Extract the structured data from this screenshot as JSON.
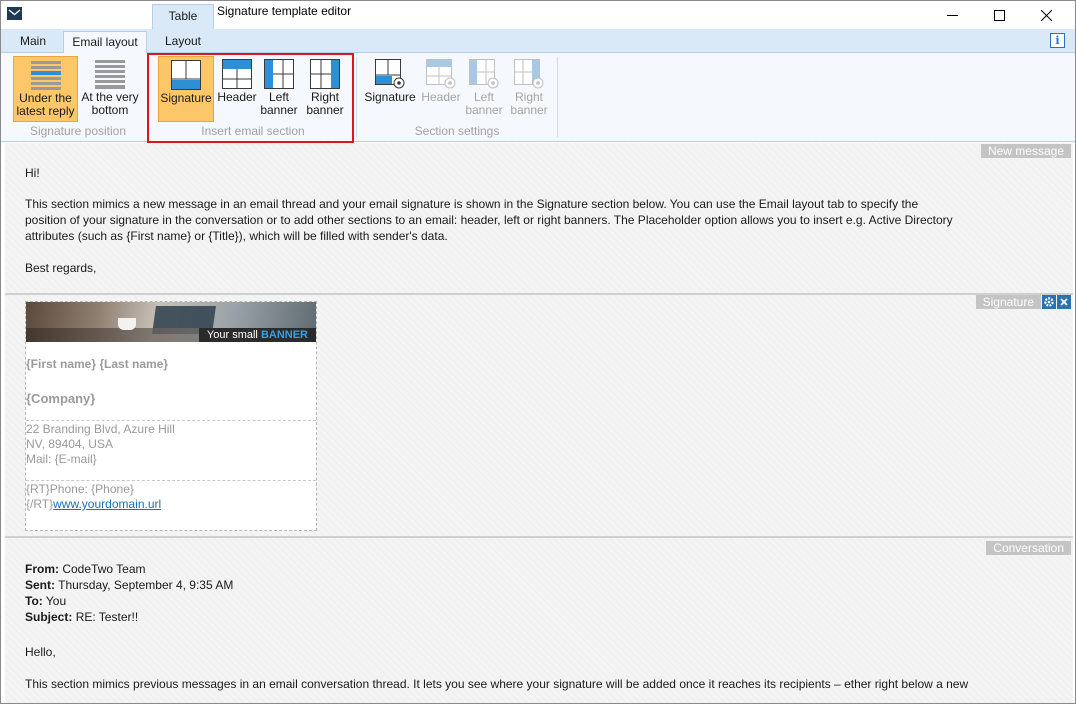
{
  "window": {
    "title": "Signature template editor",
    "context_tab": "Table"
  },
  "tabs": [
    {
      "label": "Main",
      "active": false
    },
    {
      "label": "Email layout",
      "active": true
    },
    {
      "label": "Layout",
      "active": false
    }
  ],
  "ribbon": {
    "position_group": {
      "label": "Signature position",
      "buttons": [
        {
          "label_line1": "Under the",
          "label_line2": "latest reply",
          "selected": true
        },
        {
          "label_line1": "At the very",
          "label_line2": "bottom",
          "selected": false
        }
      ]
    },
    "insert_group": {
      "label": "Insert email section",
      "buttons": [
        {
          "label_line1": "Signature",
          "label_line2": "",
          "selected": true
        },
        {
          "label_line1": "Header",
          "label_line2": ""
        },
        {
          "label_line1": "Left",
          "label_line2": "banner"
        },
        {
          "label_line1": "Right",
          "label_line2": "banner"
        }
      ]
    },
    "settings_group": {
      "label": "Section settings",
      "buttons": [
        {
          "label_line1": "Signature",
          "label_line2": "",
          "enabled": true
        },
        {
          "label_line1": "Header",
          "label_line2": "",
          "enabled": false
        },
        {
          "label_line1": "Left",
          "label_line2": "banner",
          "enabled": false
        },
        {
          "label_line1": "Right",
          "label_line2": "banner",
          "enabled": false
        }
      ]
    }
  },
  "new_message": {
    "tag": "New message",
    "greeting": "Hi!",
    "body_line1": "This section mimics a new message in an email thread and your email signature is shown in the Signature section below. You can use the Email layout tab to specify the",
    "body_line2": "position of your signature in the conversation or to add other sections to an email: header, left or right banners. The Placeholder option allows you to insert e.g. Active Directory",
    "body_line3": "attributes (such as {First name} or {Title}), which will be filled with sender's data.",
    "closing": "Best regards,"
  },
  "signature": {
    "tag": "Signature",
    "banner_text": "Your small",
    "banner_highlight": "BANNER",
    "name": "{First name} {Last name}",
    "company": "{Company}",
    "address1": "22 Branding Blvd, Azure Hill",
    "address2": "NV, 89404, USA",
    "mail": "Mail: {E-mail}",
    "phone": "{RT}Phone: {Phone}",
    "url_prefix": "{/RT}",
    "url": "www.yourdomain.url"
  },
  "conversation": {
    "tag": "Conversation",
    "from_label": "From:",
    "from": "CodeTwo Team",
    "sent_label": "Sent:",
    "sent": "Thursday, September 4, 9:35 AM",
    "to_label": "To:",
    "to": "You",
    "subject_label": "Subject:",
    "subject": "RE: Tester!!",
    "greeting": "Hello,",
    "body_line1": "This section mimics previous messages in an email conversation thread. It lets you see where your signature will be added once it reaches its recipients – ether right below a new"
  },
  "colors": {
    "ribbon_bg": "#f5f9fd",
    "tab_strip": "#dae9f7",
    "selected_button": "#fcc768",
    "highlight_border": "#e0141a",
    "section_tag": "#c4c4c4",
    "accent_blue": "#2a72b0"
  }
}
